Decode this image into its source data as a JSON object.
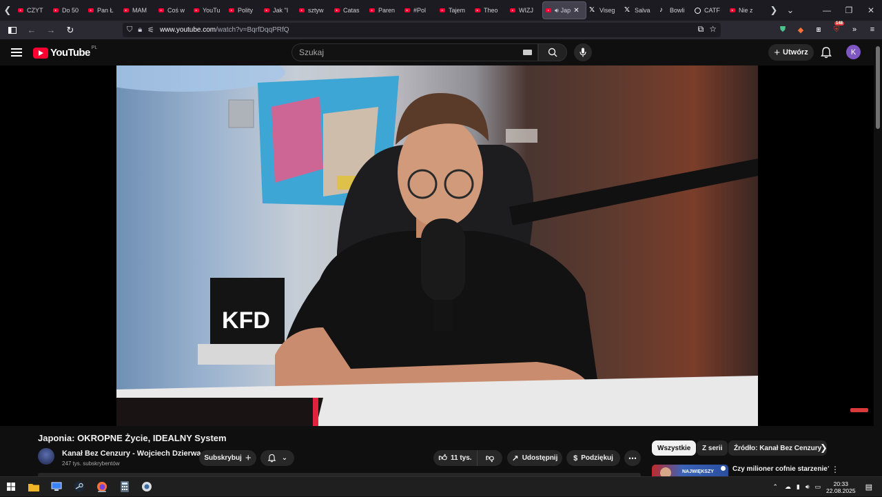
{
  "browser": {
    "tabs": [
      {
        "label": "CZYT",
        "icon": "youtube"
      },
      {
        "label": "Do 50",
        "icon": "youtube"
      },
      {
        "label": "Pan Ł",
        "icon": "youtube"
      },
      {
        "label": "MAM",
        "icon": "youtube"
      },
      {
        "label": "Coś w",
        "icon": "youtube"
      },
      {
        "label": "YouTu",
        "icon": "youtube"
      },
      {
        "label": "Polity",
        "icon": "youtube"
      },
      {
        "label": "Jak \"I",
        "icon": "youtube"
      },
      {
        "label": "sztyw",
        "icon": "youtube"
      },
      {
        "label": "Catas",
        "icon": "youtube"
      },
      {
        "label": "Paren",
        "icon": "youtube"
      },
      {
        "label": "#Pol",
        "icon": "youtube"
      },
      {
        "label": "Tajem",
        "icon": "youtube"
      },
      {
        "label": "Theo",
        "icon": "youtube"
      },
      {
        "label": "WIZJ",
        "icon": "youtube"
      },
      {
        "label": "Jap",
        "icon": "youtube",
        "active": true
      },
      {
        "label": "Viseg",
        "icon": "x"
      },
      {
        "label": "Salva",
        "icon": "x"
      },
      {
        "label": "Bowli",
        "icon": "tiktok"
      },
      {
        "label": "CATF",
        "icon": "cat"
      },
      {
        "label": "Nie z",
        "icon": "youtube"
      }
    ],
    "url_host": "www.youtube.com",
    "url_path": "/watch?v=BqrfDqqPRfQ",
    "extension_badge": "148"
  },
  "youtube": {
    "logo_text": "YouTube",
    "country_code": "PL",
    "search_placeholder": "Szukaj",
    "create_label": "Utwórz",
    "avatar_letter": "K",
    "video_title": "Japonia: OKROPNE Życie, IDEALNY System",
    "channel_name": "Kanał Bez Cenzury - Wojciech Dzierwa",
    "subscribers": "247 tys. subskrybentów",
    "subscribe_label": "Subskrybuj",
    "likes": "11 tys.",
    "share_label": "Udostępnij",
    "thanks_label": "Podziękuj",
    "chips": [
      "Wszystkie",
      "Z serii",
      "Źródło: Kanał Bez Cenzury"
    ],
    "rec_title": "Czy milioner cofnie starzenie? - protokół BLUEPRINT",
    "rec_thumb_text": "NAJWIĘKSZY",
    "video_overlay_text": "KFD"
  },
  "taskbar": {
    "time": "20:33",
    "date": "22.08.2025"
  }
}
